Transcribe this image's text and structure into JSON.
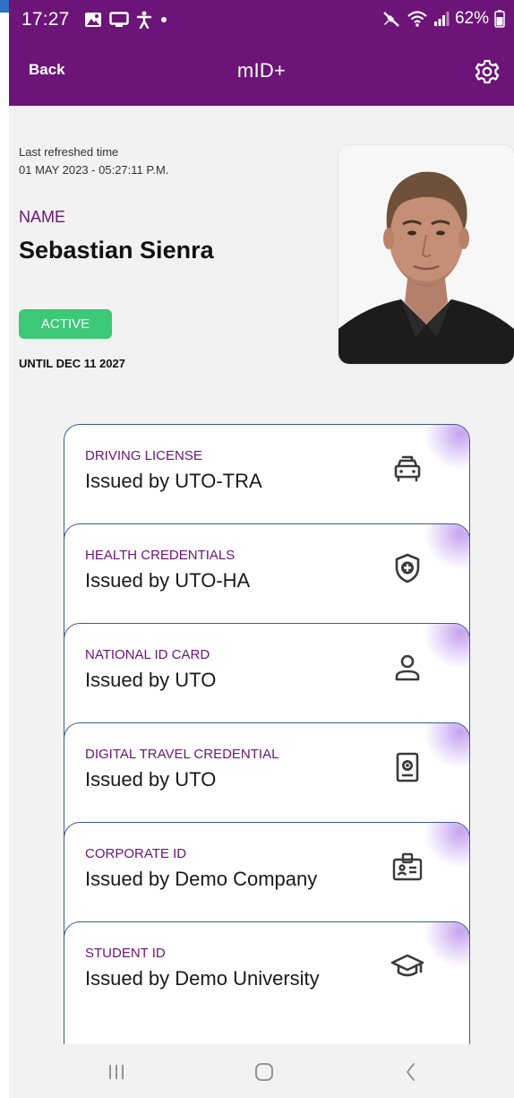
{
  "status_bar": {
    "time": "17:27",
    "battery": "62%",
    "icons": [
      "gallery-icon",
      "screen-cast-icon",
      "accessibility-icon",
      "dot-icon",
      "mute-icon",
      "wifi-icon",
      "signal-icon",
      "battery-icon"
    ]
  },
  "app_bar": {
    "back_label": "Back",
    "title": "mID+",
    "settings_icon": "gear-icon"
  },
  "profile": {
    "refresh_label": "Last refreshed time",
    "refresh_time": "01 MAY 2023 - 05:27:11 P.M.",
    "name_label": "NAME",
    "name": "Sebastian Sienra",
    "status": "ACTIVE",
    "valid_until": "UNTIL DEC 11 2027"
  },
  "credentials": [
    {
      "type": "DRIVING LICENSE",
      "issuer": "Issued by UTO-TRA",
      "icon": "car-icon"
    },
    {
      "type": "HEALTH CREDENTIALS",
      "issuer": "Issued by UTO-HA",
      "icon": "health-shield-icon"
    },
    {
      "type": "NATIONAL ID CARD",
      "issuer": "Issued by UTO",
      "icon": "person-icon"
    },
    {
      "type": "DIGITAL TRAVEL CREDENTIAL",
      "issuer": "Issued by UTO",
      "icon": "passport-icon"
    },
    {
      "type": "CORPORATE ID",
      "issuer": "Issued by Demo Company",
      "icon": "badge-icon"
    },
    {
      "type": "STUDENT ID",
      "issuer": "Issued by Demo University",
      "icon": "graduation-cap-icon"
    }
  ],
  "colors": {
    "brand": "#6c1477",
    "active": "#3cc877",
    "card_border": "#3f5a8f"
  }
}
